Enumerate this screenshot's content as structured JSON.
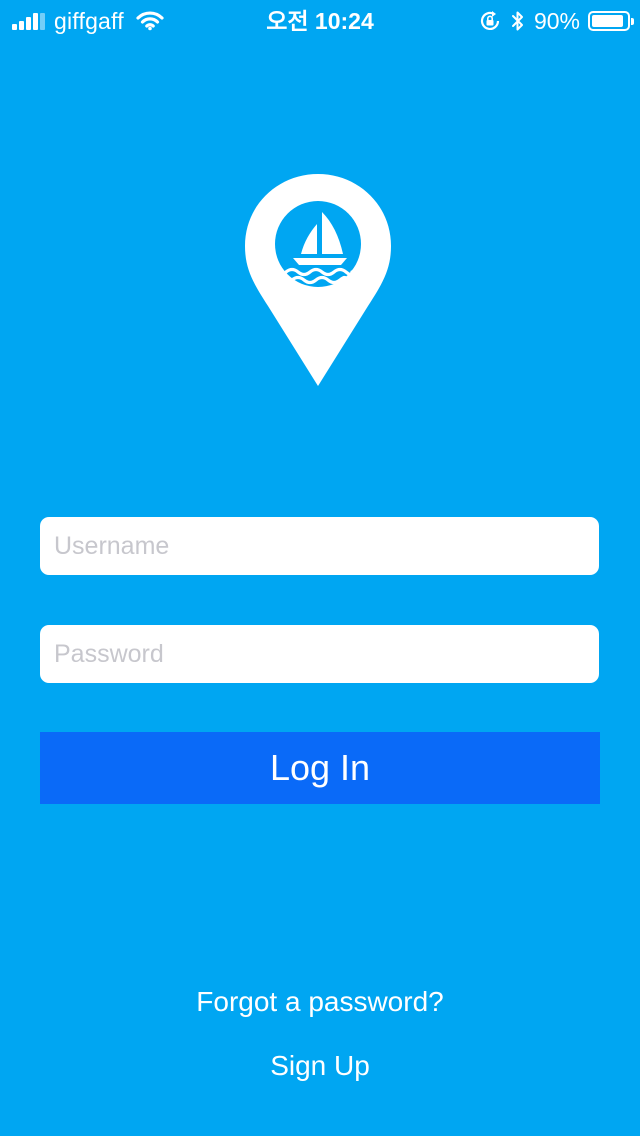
{
  "status_bar": {
    "carrier": "giffgaff",
    "time": "오전 10:24",
    "battery_percent": "90%",
    "battery_level": 0.9,
    "signal_bars_filled": 4,
    "icons": [
      "signal-icon",
      "wifi-icon",
      "rotation-lock-icon",
      "bluetooth-icon",
      "battery-icon"
    ]
  },
  "logo": {
    "icon": "map-pin-sailboat-icon",
    "pin_color": "#ffffff",
    "inner_color": "#00a6f2"
  },
  "form": {
    "username_placeholder": "Username",
    "username_value": "",
    "password_placeholder": "Password",
    "password_value": ""
  },
  "actions": {
    "login_label": "Log In",
    "forgot_label": "Forgot a password?",
    "signup_label": "Sign Up"
  },
  "colors": {
    "background": "#00a6f2",
    "button": "#0a6af8",
    "text": "#ffffff",
    "placeholder": "#c7c7cd"
  }
}
